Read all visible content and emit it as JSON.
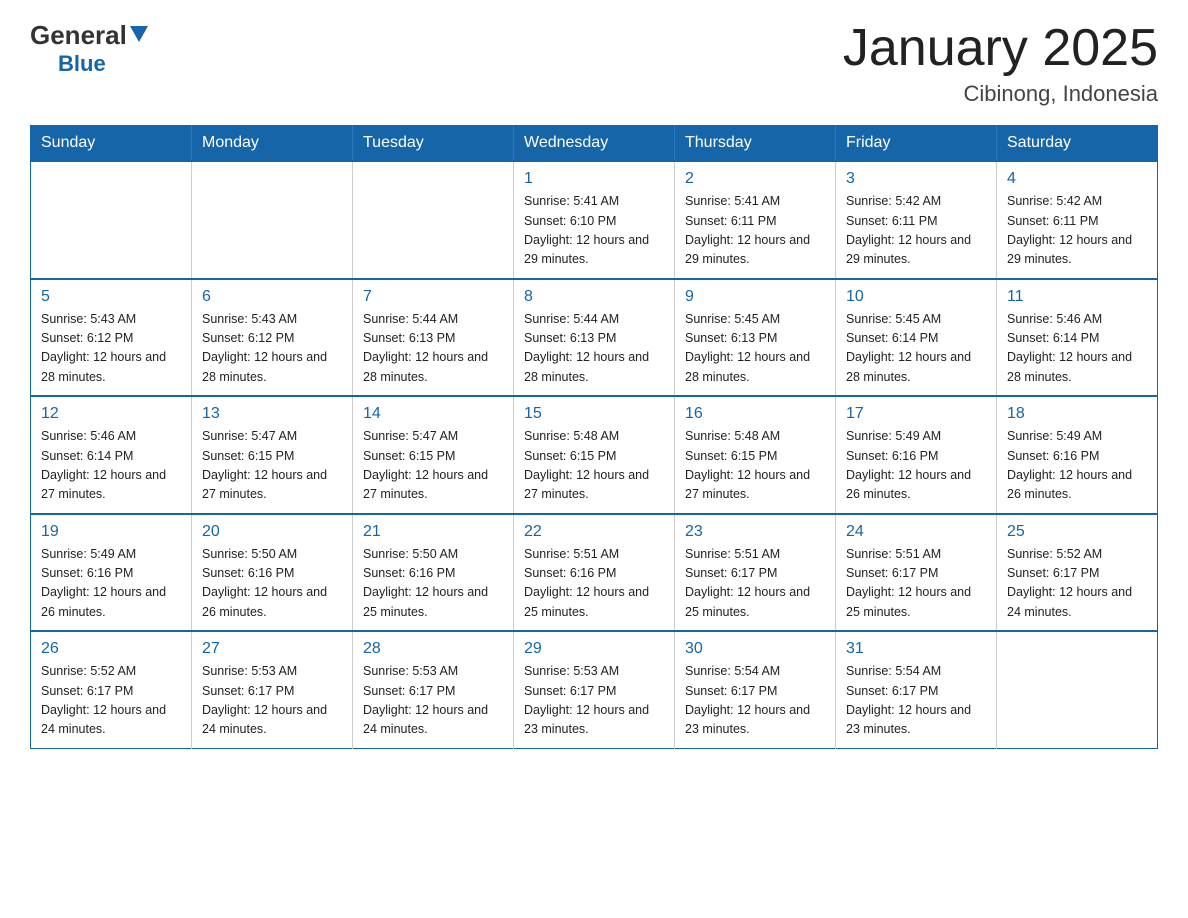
{
  "header": {
    "logo_general": "General",
    "logo_blue": "Blue",
    "title": "January 2025",
    "subtitle": "Cibinong, Indonesia"
  },
  "days_of_week": [
    "Sunday",
    "Monday",
    "Tuesday",
    "Wednesday",
    "Thursday",
    "Friday",
    "Saturday"
  ],
  "weeks": [
    [
      {
        "day": "",
        "info": ""
      },
      {
        "day": "",
        "info": ""
      },
      {
        "day": "",
        "info": ""
      },
      {
        "day": "1",
        "info": "Sunrise: 5:41 AM\nSunset: 6:10 PM\nDaylight: 12 hours\nand 29 minutes."
      },
      {
        "day": "2",
        "info": "Sunrise: 5:41 AM\nSunset: 6:11 PM\nDaylight: 12 hours\nand 29 minutes."
      },
      {
        "day": "3",
        "info": "Sunrise: 5:42 AM\nSunset: 6:11 PM\nDaylight: 12 hours\nand 29 minutes."
      },
      {
        "day": "4",
        "info": "Sunrise: 5:42 AM\nSunset: 6:11 PM\nDaylight: 12 hours\nand 29 minutes."
      }
    ],
    [
      {
        "day": "5",
        "info": "Sunrise: 5:43 AM\nSunset: 6:12 PM\nDaylight: 12 hours\nand 28 minutes."
      },
      {
        "day": "6",
        "info": "Sunrise: 5:43 AM\nSunset: 6:12 PM\nDaylight: 12 hours\nand 28 minutes."
      },
      {
        "day": "7",
        "info": "Sunrise: 5:44 AM\nSunset: 6:13 PM\nDaylight: 12 hours\nand 28 minutes."
      },
      {
        "day": "8",
        "info": "Sunrise: 5:44 AM\nSunset: 6:13 PM\nDaylight: 12 hours\nand 28 minutes."
      },
      {
        "day": "9",
        "info": "Sunrise: 5:45 AM\nSunset: 6:13 PM\nDaylight: 12 hours\nand 28 minutes."
      },
      {
        "day": "10",
        "info": "Sunrise: 5:45 AM\nSunset: 6:14 PM\nDaylight: 12 hours\nand 28 minutes."
      },
      {
        "day": "11",
        "info": "Sunrise: 5:46 AM\nSunset: 6:14 PM\nDaylight: 12 hours\nand 28 minutes."
      }
    ],
    [
      {
        "day": "12",
        "info": "Sunrise: 5:46 AM\nSunset: 6:14 PM\nDaylight: 12 hours\nand 27 minutes."
      },
      {
        "day": "13",
        "info": "Sunrise: 5:47 AM\nSunset: 6:15 PM\nDaylight: 12 hours\nand 27 minutes."
      },
      {
        "day": "14",
        "info": "Sunrise: 5:47 AM\nSunset: 6:15 PM\nDaylight: 12 hours\nand 27 minutes."
      },
      {
        "day": "15",
        "info": "Sunrise: 5:48 AM\nSunset: 6:15 PM\nDaylight: 12 hours\nand 27 minutes."
      },
      {
        "day": "16",
        "info": "Sunrise: 5:48 AM\nSunset: 6:15 PM\nDaylight: 12 hours\nand 27 minutes."
      },
      {
        "day": "17",
        "info": "Sunrise: 5:49 AM\nSunset: 6:16 PM\nDaylight: 12 hours\nand 26 minutes."
      },
      {
        "day": "18",
        "info": "Sunrise: 5:49 AM\nSunset: 6:16 PM\nDaylight: 12 hours\nand 26 minutes."
      }
    ],
    [
      {
        "day": "19",
        "info": "Sunrise: 5:49 AM\nSunset: 6:16 PM\nDaylight: 12 hours\nand 26 minutes."
      },
      {
        "day": "20",
        "info": "Sunrise: 5:50 AM\nSunset: 6:16 PM\nDaylight: 12 hours\nand 26 minutes."
      },
      {
        "day": "21",
        "info": "Sunrise: 5:50 AM\nSunset: 6:16 PM\nDaylight: 12 hours\nand 25 minutes."
      },
      {
        "day": "22",
        "info": "Sunrise: 5:51 AM\nSunset: 6:16 PM\nDaylight: 12 hours\nand 25 minutes."
      },
      {
        "day": "23",
        "info": "Sunrise: 5:51 AM\nSunset: 6:17 PM\nDaylight: 12 hours\nand 25 minutes."
      },
      {
        "day": "24",
        "info": "Sunrise: 5:51 AM\nSunset: 6:17 PM\nDaylight: 12 hours\nand 25 minutes."
      },
      {
        "day": "25",
        "info": "Sunrise: 5:52 AM\nSunset: 6:17 PM\nDaylight: 12 hours\nand 24 minutes."
      }
    ],
    [
      {
        "day": "26",
        "info": "Sunrise: 5:52 AM\nSunset: 6:17 PM\nDaylight: 12 hours\nand 24 minutes."
      },
      {
        "day": "27",
        "info": "Sunrise: 5:53 AM\nSunset: 6:17 PM\nDaylight: 12 hours\nand 24 minutes."
      },
      {
        "day": "28",
        "info": "Sunrise: 5:53 AM\nSunset: 6:17 PM\nDaylight: 12 hours\nand 24 minutes."
      },
      {
        "day": "29",
        "info": "Sunrise: 5:53 AM\nSunset: 6:17 PM\nDaylight: 12 hours\nand 23 minutes."
      },
      {
        "day": "30",
        "info": "Sunrise: 5:54 AM\nSunset: 6:17 PM\nDaylight: 12 hours\nand 23 minutes."
      },
      {
        "day": "31",
        "info": "Sunrise: 5:54 AM\nSunset: 6:17 PM\nDaylight: 12 hours\nand 23 minutes."
      },
      {
        "day": "",
        "info": ""
      }
    ]
  ]
}
